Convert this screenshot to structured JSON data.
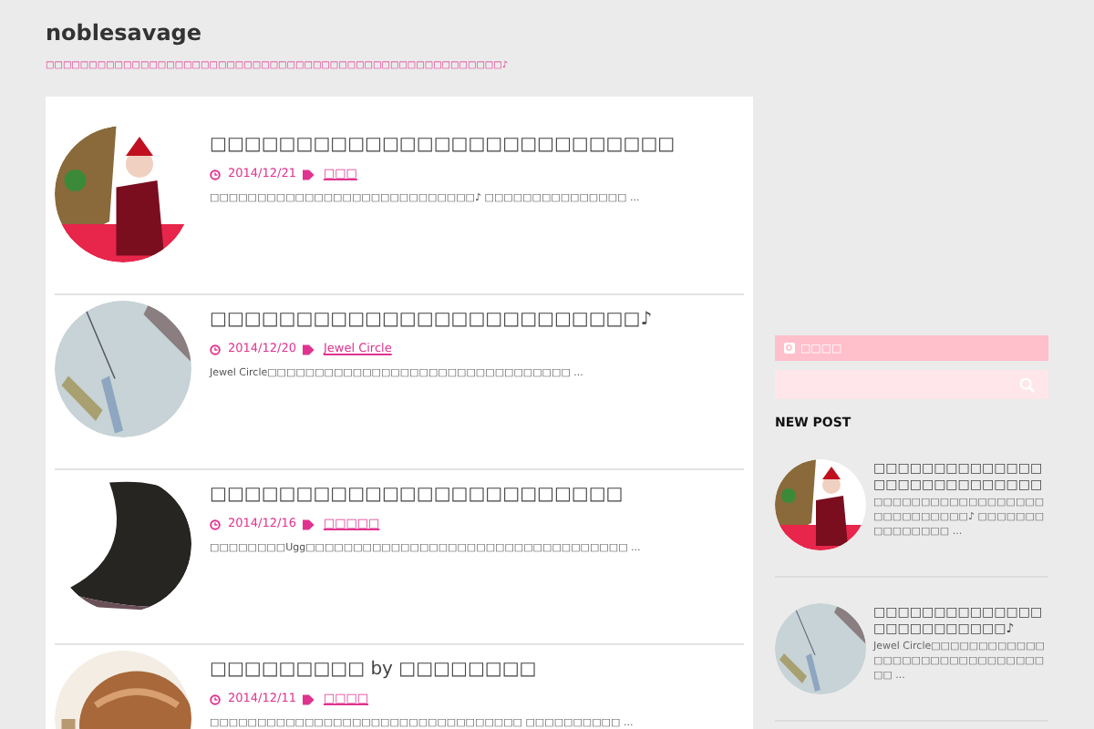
{
  "site": {
    "title": "noblesavage",
    "tagline": "□□□□□□□□□□□□□□□□□□□□□□□□□□□□□□□□□□□□□□□□□□□□□□□□□□□□□♪"
  },
  "posts": [
    {
      "title": "□□□□□□□□□□□□□□□□□□□□□□□□□□□",
      "date": "2014/12/21",
      "tag": "□□□",
      "excerpt": "□□□□□□□□□□□□□□□□□□□□□□□□□□□□♪ □□□□□□□□□□□□□□□ ..."
    },
    {
      "title": "□□□□□□□□□□□□□□□□□□□□□□□□□♪",
      "date": "2014/12/20",
      "tag": "Jewel Circle",
      "excerpt": "Jewel Circle□□□□□□□□□□□□□□□□□□□□□□□□□□□□□□□□ ..."
    },
    {
      "title": "□□□□□□□□□□□□□□□□□□□□□□□□",
      "date": "2014/12/16",
      "tag": "□□□□□",
      "excerpt": "□□□□□□□□Ugg□□□□□□□□□□□□□□□□□□□□□□□□□□□□□□□□□□ ..."
    },
    {
      "title": "□□□□□□□□□ by □□□□□□□□",
      "date": "2014/12/11",
      "tag": "□□□□",
      "excerpt": "□□□□□□□□□□□□□□□□□□□□□□□□□□□□□□□□□ □□□□□□□□□□ ..."
    }
  ],
  "sidebar": {
    "search_heading": "□□□□",
    "new_post_heading": "NEW POST",
    "new_posts": [
      {
        "title": "□□□□□□□□□□□□□□□□□□□□□□□□□□□□",
        "excerpt": "□□□□□□□□□□□□□□□□□□□□□□□□□□□□♪ □□□□□□□□□□□□□□□ ..."
      },
      {
        "title": "□□□□□□□□□□□□□□□□□□□□□□□□□♪",
        "excerpt": "Jewel Circle□□□□□□□□□□□□□□□□□□□□□□□□□□□□□□□□ ..."
      }
    ]
  }
}
